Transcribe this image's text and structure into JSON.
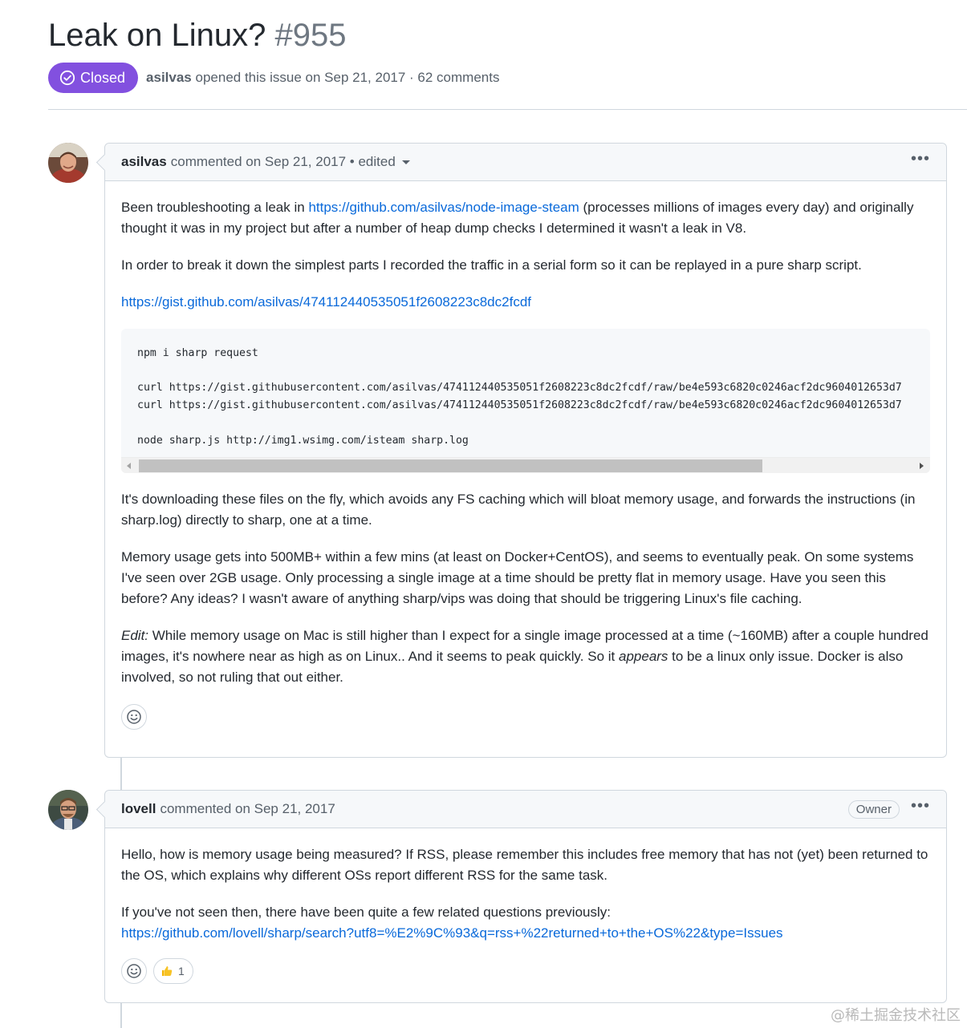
{
  "issue": {
    "title": "Leak on Linux?",
    "number": "#955",
    "state": "Closed",
    "author": "asilvas",
    "opened_text": "opened this issue on Sep 21, 2017 · 62 comments"
  },
  "comments": [
    {
      "author": "asilvas",
      "meta": "commented on Sep 21, 2017 • edited",
      "p1_before": "Been troubleshooting a leak in ",
      "p1_link": "https://github.com/asilvas/node-image-steam",
      "p1_after": " (processes millions of images every day) and originally thought it was in my project but after a number of heap dump checks I determined it wasn't a leak in V8.",
      "p2": "In order to break it down the simplest parts I recorded the traffic in a serial form so it can be replayed in a pure sharp script.",
      "gist_link": "https://gist.github.com/asilvas/474112440535051f2608223c8dc2fcdf",
      "code": "npm i sharp request\n\ncurl https://gist.githubusercontent.com/asilvas/474112440535051f2608223c8dc2fcdf/raw/be4e593c6820c0246acf2dc9604012653d7\ncurl https://gist.githubusercontent.com/asilvas/474112440535051f2608223c8dc2fcdf/raw/be4e593c6820c0246acf2dc9604012653d7\n\nnode sharp.js http://img1.wsimg.com/isteam sharp.log",
      "p3": "It's downloading these files on the fly, which avoids any FS caching which will bloat memory usage, and forwards the instructions (in sharp.log) directly to sharp, one at a time.",
      "p4": "Memory usage gets into 500MB+ within a few mins (at least on Docker+CentOS), and seems to eventually peak. On some systems I've seen over 2GB usage. Only processing a single image at a time should be pretty flat in memory usage. Have you seen this before? Any ideas? I wasn't aware of anything sharp/vips was doing that should be triggering Linux's file caching.",
      "p5_edit": "Edit:",
      "p5_a": " While memory usage on Mac is still higher than I expect for a single image processed at a time (~160MB) after a couple hundred images, it's nowhere near as high as on Linux.. And it seems to peak quickly. So it ",
      "p5_em": "appears",
      "p5_b": " to be a linux only issue. Docker is also involved, so not ruling that out either."
    },
    {
      "author": "lovell",
      "meta": "commented on Sep 21, 2017",
      "badge": "Owner",
      "p1": "Hello, how is memory usage being measured? If RSS, please remember this includes free memory that has not (yet) been returned to the OS, which explains why different OSs report different RSS for the same task.",
      "p2": "If you've not seen then, there have been quite a few related questions previously:",
      "p2_link": "https://github.com/lovell/sharp/search?utf8=%E2%9C%93&q=rss+%22returned+to+the+OS%22&type=Issues",
      "thumbs_count": "1"
    }
  ],
  "watermark": "@稀土掘金技术社区",
  "icons": {
    "state": "check-circle-icon",
    "reaction": "smiley-icon",
    "thumbs": "thumbs-up-icon",
    "more": "kebab-horizontal-icon"
  },
  "colors": {
    "closed_badge": "#8250df",
    "link": "#0969da"
  }
}
